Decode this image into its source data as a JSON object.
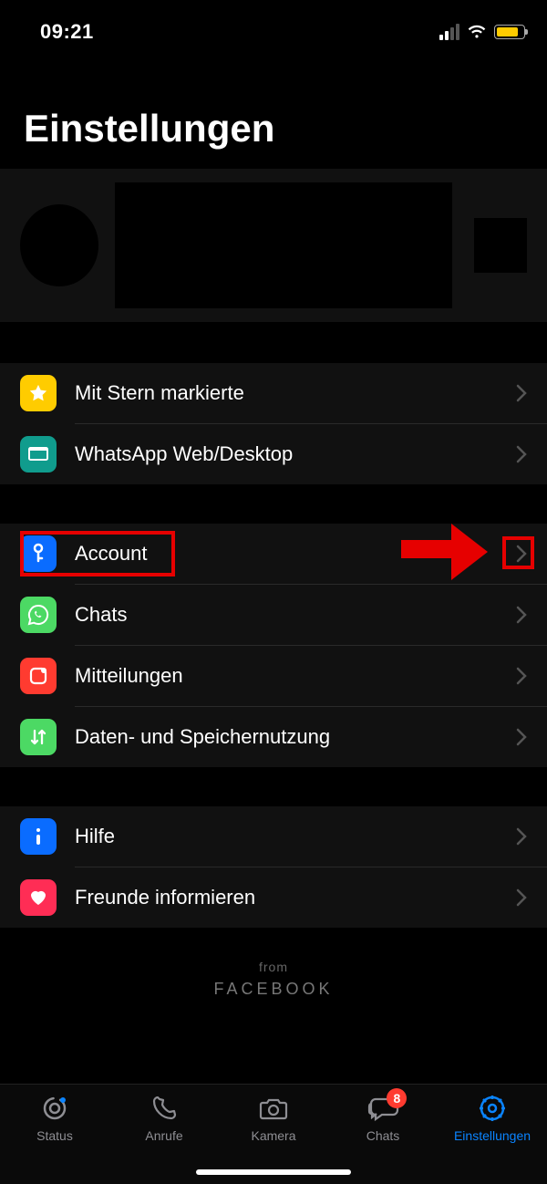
{
  "statusbar": {
    "time": "09:21"
  },
  "page": {
    "title": "Einstellungen"
  },
  "section1": {
    "starred": "Mit Stern markierte",
    "web": "WhatsApp Web/Desktop"
  },
  "section2": {
    "account": "Account",
    "chats": "Chats",
    "notifications": "Mitteilungen",
    "data": "Daten- und Speichernutzung"
  },
  "section3": {
    "help": "Hilfe",
    "tell": "Freunde informieren"
  },
  "footer": {
    "from": "from",
    "brand": "FACEBOOK"
  },
  "tabs": {
    "status": "Status",
    "calls": "Anrufe",
    "camera": "Kamera",
    "chats": "Chats",
    "settings": "Einstellungen",
    "chats_badge": "8"
  },
  "highlight_color": "#e60000"
}
